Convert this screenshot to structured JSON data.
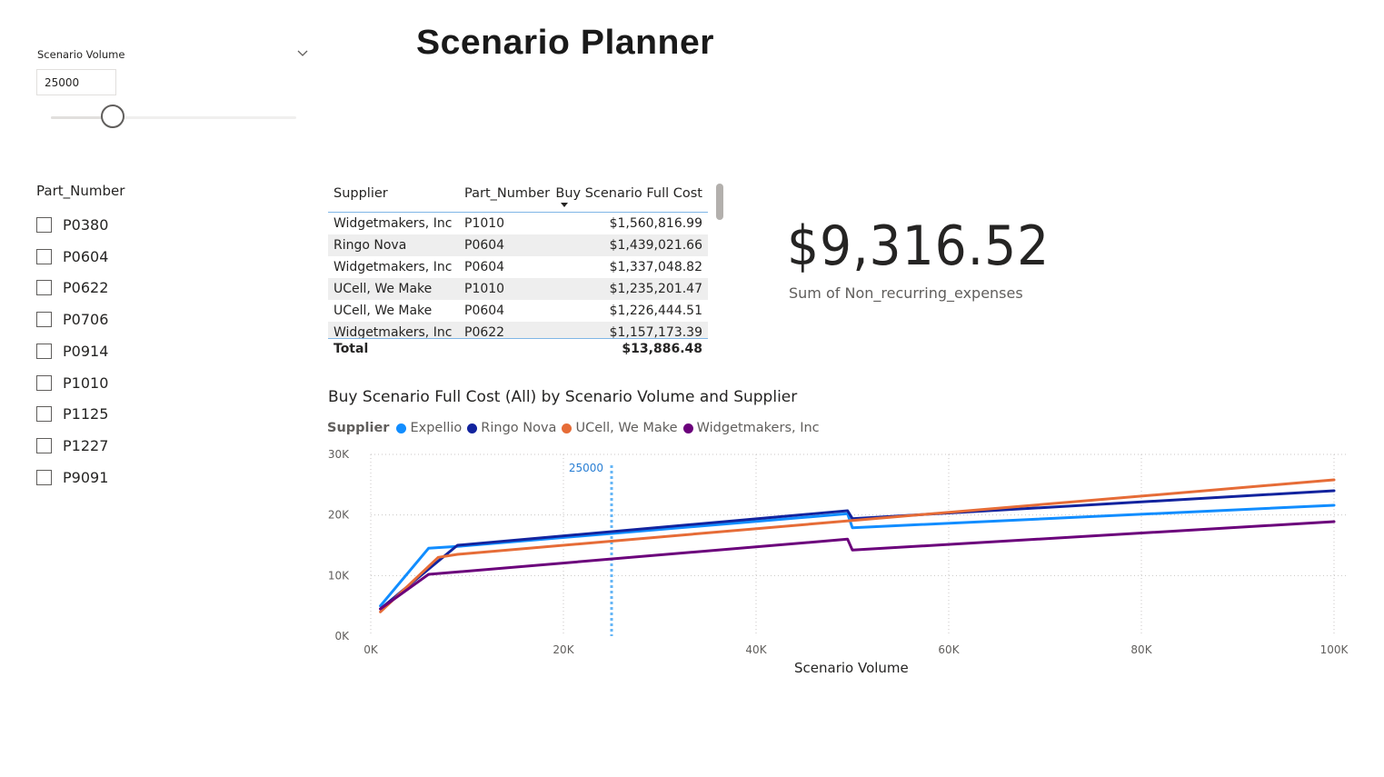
{
  "page": {
    "title": "Scenario Planner"
  },
  "scenario_slicer": {
    "label": "Scenario Volume",
    "value": "25000",
    "slider_fraction": 0.25,
    "chevron_icon": "chevron-down-icon"
  },
  "part_slicer": {
    "header": "Part_Number",
    "items": [
      {
        "label": "P0380",
        "checked": false
      },
      {
        "label": "P0604",
        "checked": false
      },
      {
        "label": "P0622",
        "checked": false
      },
      {
        "label": "P0706",
        "checked": false
      },
      {
        "label": "P0914",
        "checked": false
      },
      {
        "label": "P1010",
        "checked": false
      },
      {
        "label": "P1125",
        "checked": false
      },
      {
        "label": "P1227",
        "checked": false
      },
      {
        "label": "P9091",
        "checked": false
      }
    ]
  },
  "table": {
    "columns": [
      "Supplier",
      "Part_Number",
      "Buy Scenario Full Cost"
    ],
    "sort_icon": "sort-descending-icon",
    "rows": [
      [
        "Widgetmakers, Inc",
        "P1010",
        "$1,560,816.99"
      ],
      [
        "Ringo Nova",
        "P0604",
        "$1,439,021.66"
      ],
      [
        "Widgetmakers, Inc",
        "P0604",
        "$1,337,048.82"
      ],
      [
        "UCell, We Make",
        "P1010",
        "$1,235,201.47"
      ],
      [
        "UCell, We Make",
        "P0604",
        "$1,226,444.51"
      ],
      [
        "Widgetmakers, Inc",
        "P0622",
        "$1,157,173.39"
      ]
    ],
    "total_label": "Total",
    "total_value": "$13,886.48"
  },
  "card": {
    "value": "$9,316.52",
    "label": "Sum of Non_recurring_expenses"
  },
  "chart": {
    "title": "Buy Scenario Full Cost (All) by Scenario Volume and Supplier"
  },
  "chart_data": {
    "type": "line",
    "title": "Buy Scenario Full Cost (All) by Scenario Volume and Supplier",
    "xlabel": "Scenario Volume",
    "ylabel": "",
    "legend_title": "Supplier",
    "legend_position": "top-left",
    "xlim": [
      0,
      100000
    ],
    "ylim": [
      0,
      30000
    ],
    "x_ticks": [
      {
        "value": 0,
        "label": "0K"
      },
      {
        "value": 20000,
        "label": "20K"
      },
      {
        "value": 40000,
        "label": "40K"
      },
      {
        "value": 60000,
        "label": "60K"
      },
      {
        "value": 80000,
        "label": "80K"
      },
      {
        "value": 100000,
        "label": "100K"
      }
    ],
    "y_ticks": [
      {
        "value": 0,
        "label": "0K"
      },
      {
        "value": 10000,
        "label": "10K"
      },
      {
        "value": 20000,
        "label": "20K"
      },
      {
        "value": 30000,
        "label": "30K"
      }
    ],
    "grid": true,
    "reference_line": {
      "x": 25000,
      "label": "25000",
      "color": "#64b5f6"
    },
    "series": [
      {
        "name": "Expellio",
        "color": "#118dff",
        "points": [
          [
            1000,
            5000
          ],
          [
            6000,
            14500
          ],
          [
            9000,
            14800
          ],
          [
            49500,
            20200
          ],
          [
            50000,
            17900
          ],
          [
            100000,
            21600
          ]
        ]
      },
      {
        "name": "Ringo Nova",
        "color": "#12239e",
        "points": [
          [
            1000,
            4500
          ],
          [
            9000,
            15000
          ],
          [
            49500,
            20700
          ],
          [
            50000,
            19400
          ],
          [
            100000,
            24000
          ]
        ]
      },
      {
        "name": "UCell, We Make",
        "color": "#e66c37",
        "points": [
          [
            1000,
            4000
          ],
          [
            7000,
            13000
          ],
          [
            9000,
            13500
          ],
          [
            50000,
            19100
          ],
          [
            100000,
            25800
          ]
        ]
      },
      {
        "name": "Widgetmakers, Inc",
        "color": "#6b007b",
        "points": [
          [
            1000,
            4500
          ],
          [
            6000,
            10200
          ],
          [
            49500,
            16000
          ],
          [
            50000,
            14200
          ],
          [
            100000,
            18900
          ]
        ]
      }
    ]
  }
}
